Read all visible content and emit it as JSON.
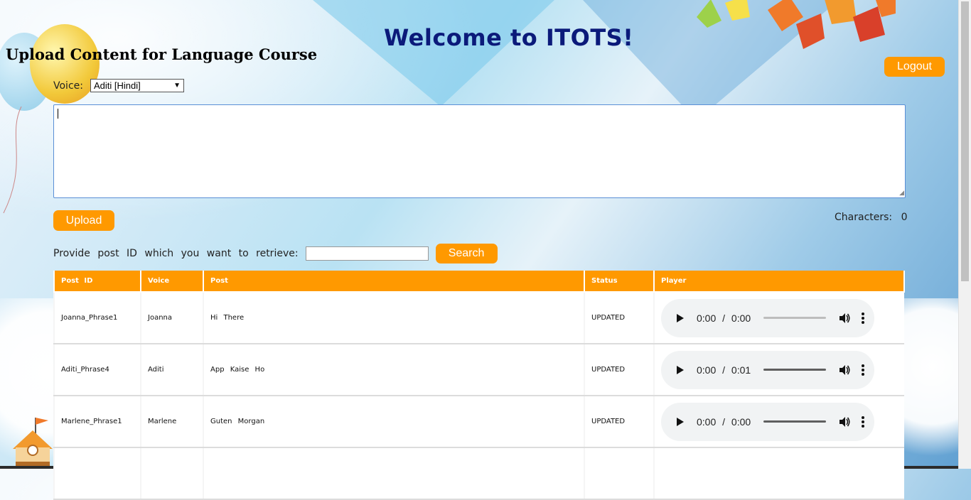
{
  "header": {
    "welcome": "Welcome to ITOTS!",
    "subheading": "Upload Content for Language Course",
    "logout_label": "Logout"
  },
  "form": {
    "voice_label": "Voice:",
    "voice_selected": "Aditi [Hindi]",
    "content_value": "",
    "upload_label": "Upload",
    "characters_label": "Characters:",
    "characters_count": "0"
  },
  "retrieve": {
    "label": "Provide post ID which you want to retrieve:",
    "input_value": "",
    "search_label": "Search"
  },
  "table": {
    "headers": [
      "Post ID",
      "Voice",
      "Post",
      "Status",
      "Player"
    ],
    "rows": [
      {
        "post_id": "Joanna_Phrase1",
        "voice": "Joanna",
        "post": "Hi There",
        "status": "UPDATED",
        "player": {
          "current": "0:00",
          "duration": "0:00",
          "played_fraction": 0,
          "loaded": false
        }
      },
      {
        "post_id": "Aditi_Phrase4",
        "voice": "Aditi",
        "post": "App Kaise Ho",
        "status": "UPDATED",
        "player": {
          "current": "0:00",
          "duration": "0:01",
          "played_fraction": 0,
          "loaded": true
        }
      },
      {
        "post_id": "Marlene_Phrase1",
        "voice": "Marlene",
        "post": "Guten Morgan",
        "status": "UPDATED",
        "player": {
          "current": "0:00",
          "duration": "0:00",
          "played_fraction": 0,
          "loaded": true
        }
      }
    ]
  },
  "colors": {
    "accent": "#ff9900",
    "title": "#0b1a7a"
  },
  "icons": {
    "play": "play-icon",
    "volume": "volume-icon",
    "more": "more-options-icon",
    "dropdown": "chevron-down-icon"
  }
}
